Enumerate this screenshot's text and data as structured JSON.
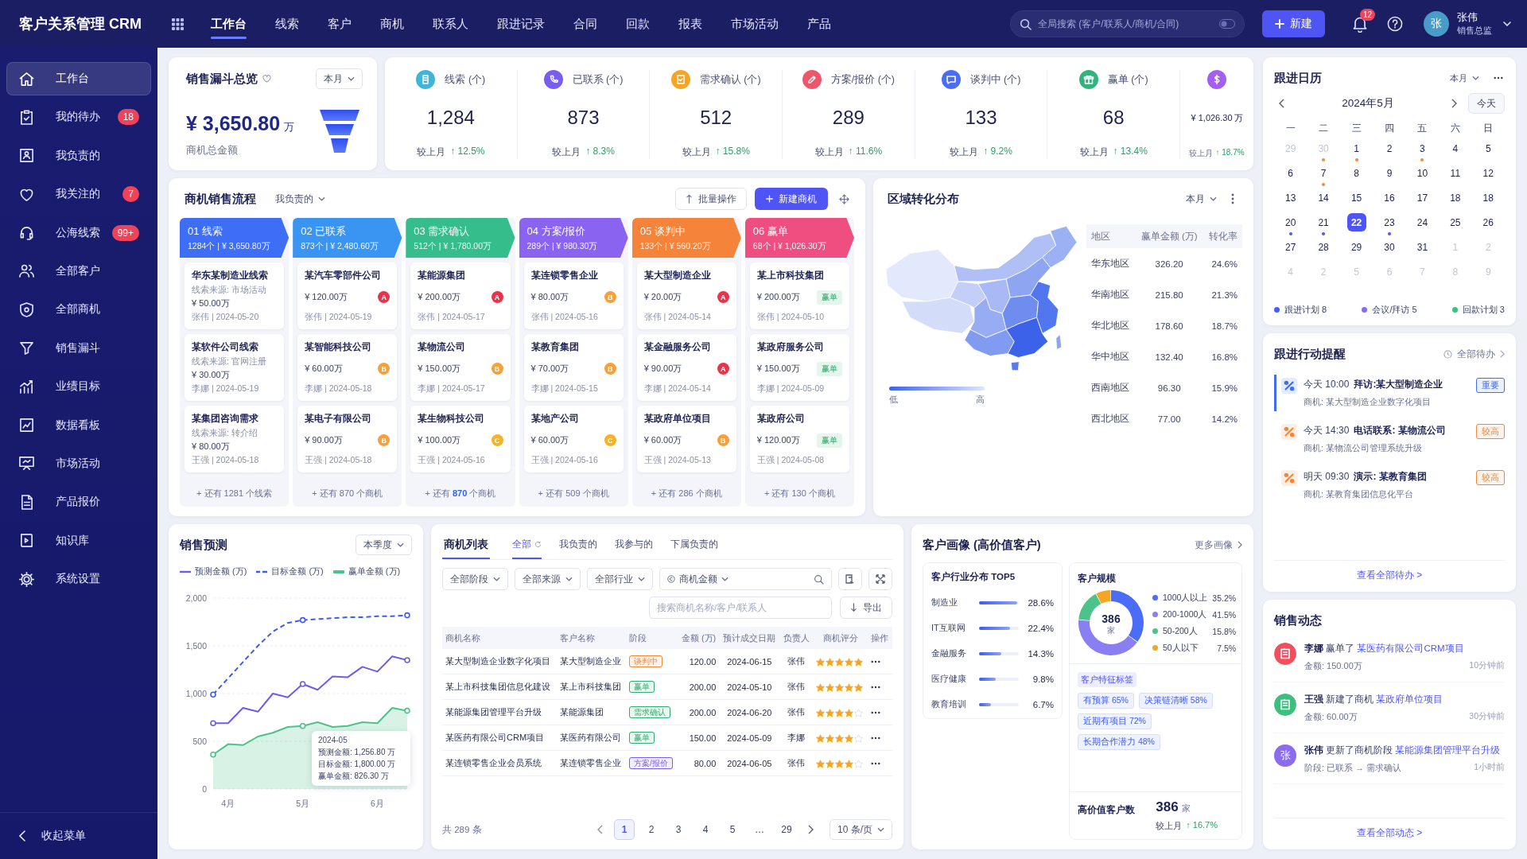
{
  "header": {
    "logo": "客户关系管理 CRM",
    "nav": [
      {
        "label": "工作台",
        "selected": true
      },
      {
        "label": "线索",
        "selected": false
      },
      {
        "label": "客户",
        "selected": false
      },
      {
        "label": "商机",
        "selected": false
      },
      {
        "label": "联系人",
        "selected": false
      },
      {
        "label": "跟进记录",
        "selected": false
      },
      {
        "label": "合同",
        "selected": false
      },
      {
        "label": "回款",
        "selected": false
      },
      {
        "label": "报表",
        "selected": false
      },
      {
        "label": "市场活动",
        "selected": false
      },
      {
        "label": "产品",
        "selected": false
      }
    ],
    "search": {
      "placeholder": "全局搜索 (客户/联系人/商机/合同)"
    },
    "new_button": "新建",
    "notification_count": "12",
    "user": {
      "avatar": "张",
      "name": "张伟",
      "role": "销售总监"
    }
  },
  "sidebar": {
    "items": [
      {
        "label": "工作台",
        "selected": true
      },
      {
        "label": "我的待办",
        "selected": false,
        "badge": "18"
      },
      {
        "label": "我负责的",
        "selected": false
      },
      {
        "label": "我关注的",
        "selected": false,
        "badge": "7"
      },
      {
        "label": "公海线索",
        "selected": false,
        "badge": "99+"
      },
      {
        "label": "全部客户",
        "selected": false
      },
      {
        "label": "全部商机",
        "selected": false
      },
      {
        "label": "销售漏斗",
        "selected": false
      },
      {
        "label": "业绩目标",
        "selected": false
      },
      {
        "label": "数据看板",
        "selected": false
      },
      {
        "label": "市场活动",
        "selected": false
      },
      {
        "label": "产品报价",
        "selected": false
      },
      {
        "label": "知识库",
        "selected": false
      },
      {
        "label": "系统设置",
        "selected": false
      }
    ],
    "collapse": "收起菜单"
  },
  "funnel_overview": {
    "title": "销售漏斗总览",
    "period": "本月",
    "amount": "¥ 3,650.80",
    "unit": "万",
    "caption": "商机总金额"
  },
  "stats": [
    {
      "label": "线索 (个)",
      "value": "1,284",
      "compare": "较上月",
      "change": "↑ 12.5%",
      "color": "#3fb6d8"
    },
    {
      "label": "已联系 (个)",
      "value": "873",
      "compare": "较上月",
      "change": "↑ 8.3%",
      "color": "#7a5cf0"
    },
    {
      "label": "需求确认 (个)",
      "value": "512",
      "compare": "较上月",
      "change": "↑ 15.8%",
      "color": "#f5a524"
    },
    {
      "label": "方案/报价 (个)",
      "value": "289",
      "compare": "较上月",
      "change": "↑ 11.6%",
      "color": "#f0566a"
    },
    {
      "label": "谈判中 (个)",
      "value": "133",
      "compare": "较上月",
      "change": "↑ 9.2%",
      "color": "#4a6cf7"
    },
    {
      "label": "赢单 (个)",
      "value": "68",
      "compare": "较上月",
      "change": "↑ 13.4%",
      "color": "#34b27d"
    }
  ],
  "stats_partial": {
    "value": "¥ 1,026.30",
    "unit": "万",
    "compare": "较上月",
    "change": "↑ 18.7%",
    "color": "#a45ff0"
  },
  "pipeline": {
    "title": "商机销售流程",
    "filter": "我负责的",
    "batch_button": "批量操作",
    "new_button": "新建商机",
    "stages": [
      {
        "name": "01 线索",
        "summary": "1284个 | ¥ 3,650.80万",
        "color": "#3d6ef5",
        "cards": [
          {
            "title": "华东某制造业线索",
            "source": "线索来源: 市场活动",
            "amount": "¥ 50.00万",
            "meta": "张伟 | 2024-05-20"
          },
          {
            "title": "某软件公司线索",
            "source": "线索来源: 官网注册",
            "amount": "¥ 30.00万",
            "meta": "李娜 | 2024-05-19"
          },
          {
            "title": "某集团咨询需求",
            "source": "线索来源: 转介绍",
            "amount": "¥ 80.00万",
            "meta": "王强 | 2024-05-18"
          }
        ],
        "more": {
          "prefix": "+ 还有",
          "count": "1281",
          "suffix": "个线索",
          "highlighted": false
        }
      },
      {
        "name": "02 已联系",
        "summary": "873个 | ¥ 2,480.60万",
        "color": "#3a94f2",
        "cards": [
          {
            "title": "某汽车零部件公司",
            "amount": "¥ 120.00万",
            "meta": "张伟 | 2024-05-19",
            "badge": {
              "kind": "grade",
              "text": "A",
              "color": "#e8344b"
            }
          },
          {
            "title": "某智能科技公司",
            "amount": "¥ 60.00万",
            "meta": "李娜 | 2024-05-18",
            "badge": {
              "kind": "grade",
              "text": "B",
              "color": "#f5a03a"
            }
          },
          {
            "title": "某电子有限公司",
            "amount": "¥ 90.00万",
            "meta": "王强 | 2024-05-18",
            "badge": {
              "kind": "grade",
              "text": "B",
              "color": "#f5a03a"
            }
          }
        ],
        "more": {
          "prefix": "+ 还有",
          "count": "870",
          "suffix": "个商机",
          "highlighted": false
        }
      },
      {
        "name": "03 需求确认",
        "summary": "512个 | ¥ 1,780.00万",
        "color": "#35bd8c",
        "cards": [
          {
            "title": "某能源集团",
            "amount": "¥ 200.00万",
            "meta": "张伟 | 2024-05-17",
            "badge": {
              "kind": "grade",
              "text": "A",
              "color": "#e8344b"
            }
          },
          {
            "title": "某物流公司",
            "amount": "¥ 150.00万",
            "meta": "李娜 | 2024-05-17",
            "badge": {
              "kind": "grade",
              "text": "B",
              "color": "#f5a03a"
            }
          },
          {
            "title": "某生物科技公司",
            "amount": "¥ 100.00万",
            "meta": "王强 | 2024-05-16",
            "badge": {
              "kind": "grade",
              "text": "C",
              "color": "#f3b12c"
            }
          }
        ],
        "more": {
          "prefix": "+ 还有",
          "count": "870",
          "suffix": "个商机",
          "highlighted": true
        }
      },
      {
        "name": "04 方案/报价",
        "summary": "289个 | ¥ 980.30万",
        "color": "#8a63f0",
        "cards": [
          {
            "title": "某连锁零售企业",
            "amount": "¥ 80.00万",
            "meta": "张伟 | 2024-05-16",
            "badge": {
              "kind": "grade",
              "text": "B",
              "color": "#f5a03a"
            }
          },
          {
            "title": "某教育集团",
            "amount": "¥ 70.00万",
            "meta": "李娜 | 2024-05-15",
            "badge": {
              "kind": "grade",
              "text": "B",
              "color": "#f5a03a"
            }
          },
          {
            "title": "某地产公司",
            "amount": "¥ 60.00万",
            "meta": "王强 | 2024-05-16",
            "badge": {
              "kind": "grade",
              "text": "C",
              "color": "#f3b12c"
            }
          }
        ],
        "more": {
          "prefix": "+ 还有",
          "count": "509",
          "suffix": "个商机",
          "highlighted": false
        }
      },
      {
        "name": "05 谈判中",
        "summary": "133个 | ¥ 560.20万",
        "color": "#f5843a",
        "cards": [
          {
            "title": "某大型制造企业",
            "amount": "¥ 20.00万",
            "meta": "张伟 | 2024-05-14",
            "badge": {
              "kind": "grade",
              "text": "A",
              "color": "#e8344b"
            }
          },
          {
            "title": "某金融服务公司",
            "amount": "¥ 90.00万",
            "meta": "李娜 | 2024-05-14",
            "badge": {
              "kind": "grade",
              "text": "A",
              "color": "#e8344b"
            }
          },
          {
            "title": "某政府单位项目",
            "amount": "¥ 60.00万",
            "meta": "王强 | 2024-05-13",
            "badge": {
              "kind": "grade",
              "text": "B",
              "color": "#f5a03a"
            }
          }
        ],
        "more": {
          "prefix": "+ 还有",
          "count": "286",
          "suffix": "个商机",
          "highlighted": false
        }
      },
      {
        "name": "06 赢单",
        "summary": "68个 | ¥ 1,026.30万",
        "color": "#ee4f80",
        "cards": [
          {
            "title": "某上市科技集团",
            "amount": "¥ 200.00万",
            "meta": "张伟 | 2024-05-10",
            "badge": {
              "kind": "tag",
              "text": "赢单"
            }
          },
          {
            "title": "某政府服务公司",
            "amount": "¥ 150.00万",
            "meta": "李娜 | 2024-05-09",
            "badge": {
              "kind": "tag",
              "text": "赢单"
            }
          },
          {
            "title": "某政府公司",
            "amount": "¥ 120.00万",
            "meta": "王强 | 2024-05-08",
            "badge": {
              "kind": "tag",
              "text": "赢单"
            }
          }
        ],
        "more": {
          "prefix": "+ 还有",
          "count": "130",
          "suffix": "个商机",
          "highlighted": false
        }
      }
    ]
  },
  "region": {
    "title": "区域转化分布",
    "period": "本月",
    "columns": [
      "地区",
      "赢单金额 (万)",
      "转化率"
    ],
    "rows": [
      [
        "华东地区",
        "326.20",
        "24.6%"
      ],
      [
        "华南地区",
        "215.80",
        "21.3%"
      ],
      [
        "华北地区",
        "178.60",
        "18.7%"
      ],
      [
        "华中地区",
        "132.40",
        "16.8%"
      ],
      [
        "西南地区",
        "96.30",
        "15.9%"
      ],
      [
        "西北地区",
        "77.00",
        "14.2%"
      ]
    ],
    "legend_low": "低",
    "legend_high": "高"
  },
  "forecast": {
    "title": "销售预测",
    "period": "本季度",
    "chart_data": {
      "type": "line",
      "grid": true,
      "categories": [
        null,
        "4月",
        null,
        null,
        null,
        null,
        "5月",
        null,
        null,
        null,
        null,
        "6月",
        null,
        null
      ],
      "ylim": [
        0,
        2000
      ],
      "yticks": [
        0,
        500,
        {
          "value": 1000,
          "label": "1,000"
        },
        {
          "value": 1500,
          "label": "1,500"
        },
        {
          "value": 2000,
          "label": "2,000"
        }
      ],
      "series": [
        {
          "name": "预测金额 (万)",
          "color": "#6d5ce8",
          "line_style": "solid",
          "values": [
            690,
            690,
            850,
            810,
            1000,
            960,
            1100,
            1040,
            1180,
            1170,
            1280,
            1230,
            1390,
            1350
          ]
        },
        {
          "name": "目标金额 (万)",
          "color": "#3d5cf0",
          "line_style": "dashed",
          "values": [
            990,
            1160,
            1330,
            1500,
            1650,
            1740,
            1770,
            1780,
            1790,
            1800,
            1800,
            1810,
            1810,
            1820
          ]
        },
        {
          "name": "赢单金额 (万)",
          "color": "#4cc38a",
          "line_style": "solid",
          "values": [
            360,
            470,
            460,
            550,
            590,
            650,
            660,
            700,
            650,
            660,
            700,
            690,
            850,
            820
          ]
        }
      ]
    },
    "tooltip": {
      "title": "2024-05",
      "lines": [
        "预测金额: 1,256.80 万",
        "目标金额: 1,800.00 万",
        "赢单金额: 826.30 万"
      ]
    }
  },
  "opportunities": {
    "title": "商机列表",
    "tabs": [
      {
        "label": "全部",
        "selected": true
      },
      {
        "label": "我负责的",
        "selected": false
      },
      {
        "label": "我参与的",
        "selected": false
      },
      {
        "label": "下属负责的",
        "selected": false
      }
    ],
    "filters": [
      "全部阶段",
      "全部来源",
      "全部行业"
    ],
    "amount_filter": "商机金额",
    "search": {
      "placeholder": "搜索商机名称/客户/联系人"
    },
    "export_button": "导出",
    "columns": [
      "商机名称",
      "客户名称",
      "阶段",
      "金额 (万)",
      "预计成交日期",
      "负责人",
      "商机评分",
      "操作"
    ],
    "rows": [
      {
        "name": "某大型制造企业数字化项目",
        "customer": "某大型制造企业",
        "stage": "谈判中",
        "color": "#f0883a",
        "amount": "120.00",
        "date": "2024-06-15",
        "owner": "张伟",
        "stars": 5
      },
      {
        "name": "某上市科技集团信息化建设",
        "customer": "某上市科技集团",
        "stage": "赢单",
        "color": "#2fae6f",
        "amount": "200.00",
        "date": "2024-05-10",
        "owner": "张伟",
        "stars": 5
      },
      {
        "name": "某能源集团管理平台升级",
        "customer": "某能源集团",
        "stage": "需求确认",
        "color": "#2fae6f",
        "amount": "200.00",
        "date": "2024-06-20",
        "owner": "张伟",
        "stars": 4
      },
      {
        "name": "某医药有限公司CRM项目",
        "customer": "某医药有限公司",
        "stage": "赢单",
        "color": "#2fae6f",
        "amount": "150.00",
        "date": "2024-05-09",
        "owner": "李娜",
        "stars": 4
      },
      {
        "name": "某连锁零售企业会员系统",
        "customer": "某连锁零售企业",
        "stage": "方案/报价",
        "color": "#7a5cf0",
        "amount": "80.00",
        "date": "2024-06-05",
        "owner": "张伟",
        "stars": 4
      }
    ],
    "pagination": {
      "total": "共 289 条",
      "pages": [
        {
          "label": "1",
          "selected": true
        },
        {
          "label": "2",
          "selected": false
        },
        {
          "label": "3",
          "selected": false
        },
        {
          "label": "4",
          "selected": false
        },
        {
          "label": "5",
          "selected": false
        },
        {
          "label": "…",
          "selected": false
        },
        {
          "label": "29",
          "selected": false
        }
      ],
      "page_size": "10 条/页"
    }
  },
  "portrait": {
    "title": "客户画像 (高价值客户)",
    "more": "更多画像",
    "industry": {
      "title": "客户行业分布 TOP5",
      "items": [
        {
          "name": "制造业",
          "value": "28.6%",
          "level": 0.95
        },
        {
          "name": "IT互联网",
          "value": "22.4%",
          "level": 0.78
        },
        {
          "name": "金融服务",
          "value": "14.3%",
          "level": 0.56
        },
        {
          "name": "医疗健康",
          "value": "9.8%",
          "level": 0.42
        },
        {
          "name": "教育培训",
          "value": "6.7%",
          "level": 0.3
        }
      ]
    },
    "scale": {
      "title": "客户规模",
      "center_value": "386",
      "center_unit": "家",
      "chart_data": {
        "type": "donut",
        "categories": [
          "1000人以上",
          "200-1000人",
          "50-200人",
          "50人以下"
        ],
        "values": [
          35.2,
          41.5,
          15.8,
          7.5
        ]
      },
      "legend": [
        {
          "value": "35.2%",
          "color": "#4a6cf7"
        },
        {
          "value": "41.5%",
          "color": "#8a7ff2"
        },
        {
          "value": "15.8%",
          "color": "#4cc38a"
        },
        {
          "value": "7.5%",
          "color": "#f5a524"
        }
      ]
    },
    "tags": {
      "title": "客户特征标签",
      "items": [
        "有预算 65%",
        "决策链清晰 58%",
        "近期有项目 72%",
        "长期合作潜力 48%"
      ]
    },
    "high_value": {
      "label": "高价值客户数",
      "value": "386",
      "unit": "家",
      "compare": "较上月",
      "change": "↑ 16.7%"
    }
  },
  "calendar": {
    "title": "跟进日历",
    "period": "本月",
    "month": "2024年5月",
    "today_button": "今天",
    "weekdays": [
      "一",
      "二",
      "三",
      "四",
      "五",
      "六",
      "日"
    ],
    "days": [
      {
        "text": "29",
        "muted": true,
        "selected": false
      },
      {
        "text": "30",
        "muted": true,
        "selected": false,
        "color": "#f08a3c"
      },
      {
        "text": "1",
        "muted": false,
        "selected": false,
        "color": "#f08a3c"
      },
      {
        "text": "2",
        "muted": false,
        "selected": false
      },
      {
        "text": "3",
        "muted": false,
        "selected": false,
        "color": "#f08a3c"
      },
      {
        "text": "4",
        "muted": false,
        "selected": false
      },
      {
        "text": "5",
        "muted": false,
        "selected": false
      },
      {
        "text": "6",
        "muted": false,
        "selected": false
      },
      {
        "text": "7",
        "muted": false,
        "selected": false,
        "color": "#f08a3c"
      },
      {
        "text": "8",
        "muted": false,
        "selected": false
      },
      {
        "text": "9",
        "muted": false,
        "selected": false
      },
      {
        "text": "10",
        "muted": false,
        "selected": false
      },
      {
        "text": "11",
        "muted": false,
        "selected": false
      },
      {
        "text": "12",
        "muted": false,
        "selected": false
      },
      {
        "text": "13",
        "muted": false,
        "selected": false
      },
      {
        "text": "14",
        "muted": false,
        "selected": false
      },
      {
        "text": "15",
        "muted": false,
        "selected": false
      },
      {
        "text": "16",
        "muted": false,
        "selected": false
      },
      {
        "text": "17",
        "muted": false,
        "selected": false
      },
      {
        "text": "18",
        "muted": false,
        "selected": false
      },
      {
        "text": "18",
        "muted": false,
        "selected": false
      },
      {
        "text": "20",
        "muted": false,
        "selected": false,
        "color": "#4a5cf5"
      },
      {
        "text": "21",
        "muted": false,
        "selected": false,
        "color": "#4a5cf5"
      },
      {
        "text": "22",
        "muted": false,
        "selected": true
      },
      {
        "text": "23",
        "muted": false,
        "selected": false,
        "color": "#4a5cf5"
      },
      {
        "text": "24",
        "muted": false,
        "selected": false
      },
      {
        "text": "25",
        "muted": false,
        "selected": false
      },
      {
        "text": "26",
        "muted": false,
        "selected": false
      },
      {
        "text": "27",
        "muted": false,
        "selected": false
      },
      {
        "text": "28",
        "muted": false,
        "selected": false
      },
      {
        "text": "29",
        "muted": false,
        "selected": false
      },
      {
        "text": "30",
        "muted": false,
        "selected": false
      },
      {
        "text": "31",
        "muted": false,
        "selected": false
      },
      {
        "text": "1",
        "muted": true,
        "selected": false
      },
      {
        "text": "2",
        "muted": true,
        "selected": false
      },
      {
        "text": "4",
        "muted": true,
        "selected": false
      },
      {
        "text": "2",
        "muted": true,
        "selected": false
      },
      {
        "text": "5",
        "muted": true,
        "selected": false
      },
      {
        "text": "6",
        "muted": true,
        "selected": false
      },
      {
        "text": "7",
        "muted": true,
        "selected": false
      },
      {
        "text": "8",
        "muted": true,
        "selected": false
      },
      {
        "text": "9",
        "muted": true,
        "selected": false
      }
    ],
    "legend": [
      {
        "label": "跟进计划 8",
        "color": "#4a5cf5"
      },
      {
        "label": "会议/拜访 5",
        "color": "#8b6cf0"
      },
      {
        "label": "回款计划 3",
        "color": "#3cbf7f"
      }
    ]
  },
  "reminders": {
    "title": "跟进行动提醒",
    "all_link": "全部待办",
    "items": [
      {
        "time": "今天 10:00",
        "title": "拜访:某大型制造企业",
        "subtitle": "商机: 某大型制造企业数字化项目",
        "tag": "重要",
        "color": "#3d6ef5",
        "selected": true
      },
      {
        "time": "今天 14:30",
        "title": "电话联系: 某物流公司",
        "subtitle": "商机: 某物流公司管理系统升级",
        "tag": "较高",
        "color": "#f0883a",
        "selected": false
      },
      {
        "time": "明天 09:30",
        "title": "演示: 某教育集团",
        "subtitle": "商机: 某教育集团信息化平台",
        "tag": "较高",
        "color": "#f0883a",
        "selected": false
      }
    ],
    "footer": "查看全部待办 >"
  },
  "activity": {
    "title": "销售动态",
    "items": [
      {
        "kind": "icon",
        "color": "#ef4f5f",
        "actor": "李娜",
        "action": "赢单了",
        "link": "某医药有限公司CRM项目",
        "time": "10分钟前",
        "detail": "金额: 150.00万"
      },
      {
        "kind": "icon",
        "color": "#3cbf7f",
        "actor": "王强",
        "action": "新建了商机",
        "link": "某政府单位项目",
        "time": "30分钟前",
        "detail": "金额: 60.00万"
      },
      {
        "kind": "text",
        "avatar": "张",
        "color": "#8b6cf0",
        "actor": "张伟",
        "action": "更新了商机阶段",
        "link": "某能源集团管理平台升级",
        "time": "1小时前",
        "detail": "阶段: 已联系 → 需求确认"
      }
    ],
    "footer": "查看全部动态 >"
  }
}
